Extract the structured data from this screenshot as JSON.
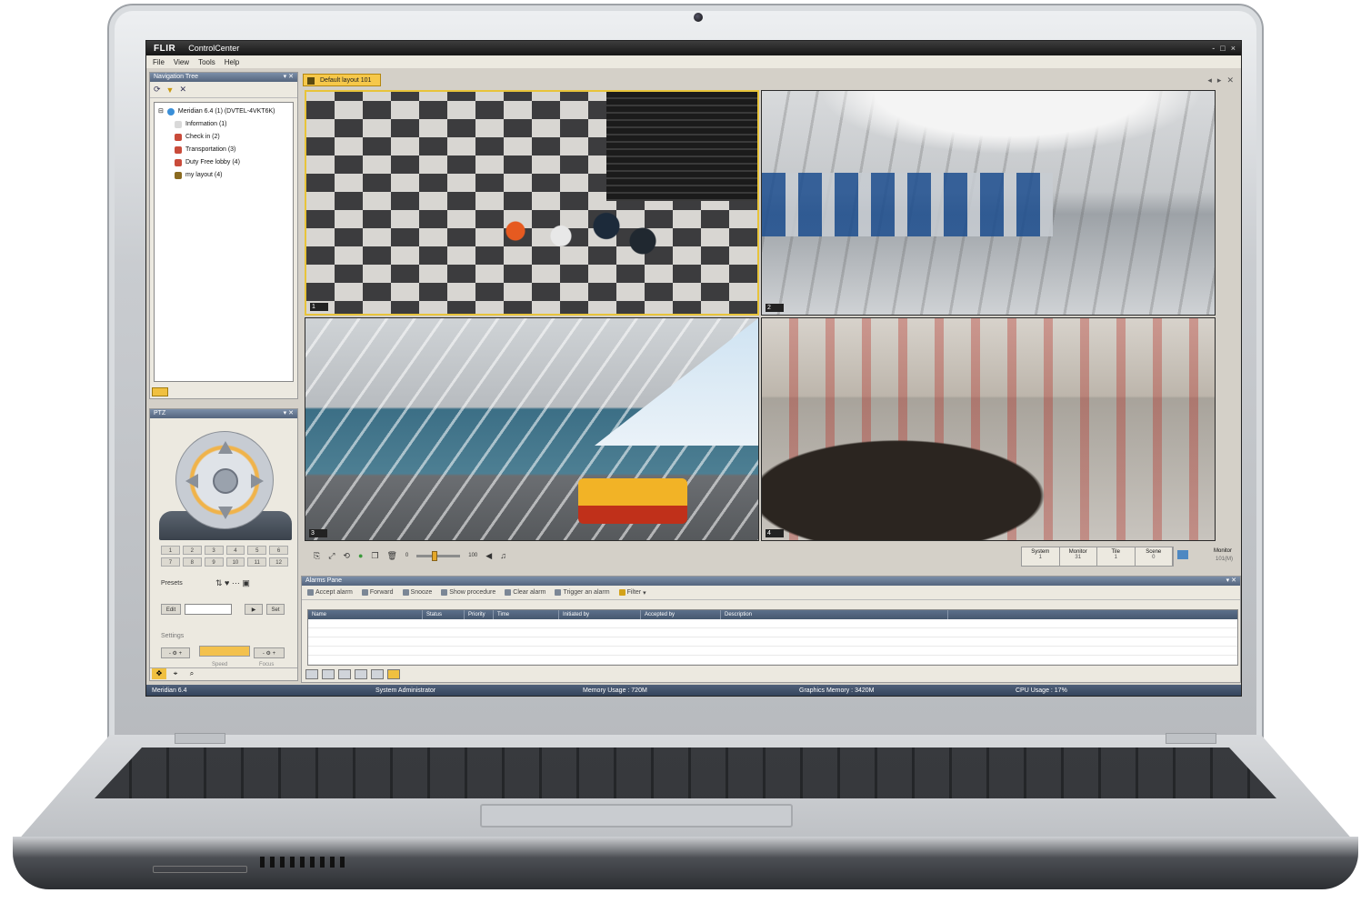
{
  "window": {
    "logo": "FLIR",
    "title": "ControlCenter",
    "controls": [
      "-",
      "□",
      "×"
    ]
  },
  "menu": [
    "File",
    "View",
    "Tools",
    "Help"
  ],
  "navigation_tree": {
    "header": "Navigation Tree",
    "root": "Meridian 6.4 (1) (DVTEL-4VKT6K)",
    "items": [
      {
        "label": "Information (1)",
        "color": "#d9d9d9"
      },
      {
        "label": "Check in (2)",
        "color": "#c94b3a"
      },
      {
        "label": "Transportation (3)",
        "color": "#c94b3a"
      },
      {
        "label": "Duty Free lobby (4)",
        "color": "#c94b3a"
      },
      {
        "label": "my layout (4)",
        "color": "#8a6a20"
      }
    ]
  },
  "ptz": {
    "header": "PTZ",
    "presets_label": "Presets",
    "preset_numbers": [
      "1",
      "2",
      "3",
      "4",
      "5",
      "6",
      "7",
      "8",
      "9",
      "10",
      "11",
      "12"
    ],
    "edit_label": "Edit",
    "set_label": "Set",
    "settings_label": "Settings",
    "speed_label": "Speed",
    "focus_label": "Focus"
  },
  "layout": {
    "tab_label": "Default layout 101",
    "tiles": [
      "1",
      "2",
      "3",
      "4"
    ]
  },
  "video_toolbar": {
    "zoom_min": "0",
    "zoom_max": "100",
    "zoom_level": 0.4
  },
  "counters": [
    {
      "label": "System",
      "value": "1"
    },
    {
      "label": "Monitor",
      "value": "31"
    },
    {
      "label": "Tile",
      "value": "1"
    },
    {
      "label": "Scene",
      "value": "0"
    }
  ],
  "monitor": {
    "label": "Monitor",
    "value": "101(M)"
  },
  "alarm_pane": {
    "header": "Alarms Pane",
    "buttons": [
      "Accept alarm",
      "Forward",
      "Snooze",
      "Show procedure",
      "Clear alarm",
      "Trigger an alarm",
      "Filter"
    ],
    "columns": [
      "Name",
      "Status",
      "Priority",
      "Time",
      "Initiated by",
      "Accepted by",
      "Description"
    ]
  },
  "status_bar": {
    "server": "Meridian 6.4",
    "user": "System Administrator",
    "memory": "Memory Usage : 720M",
    "graphics": "Graphics Memory : 3420M",
    "cpu": "CPU Usage : 17%"
  },
  "accent_color": "#f6c84a",
  "header_color": "#54657e"
}
